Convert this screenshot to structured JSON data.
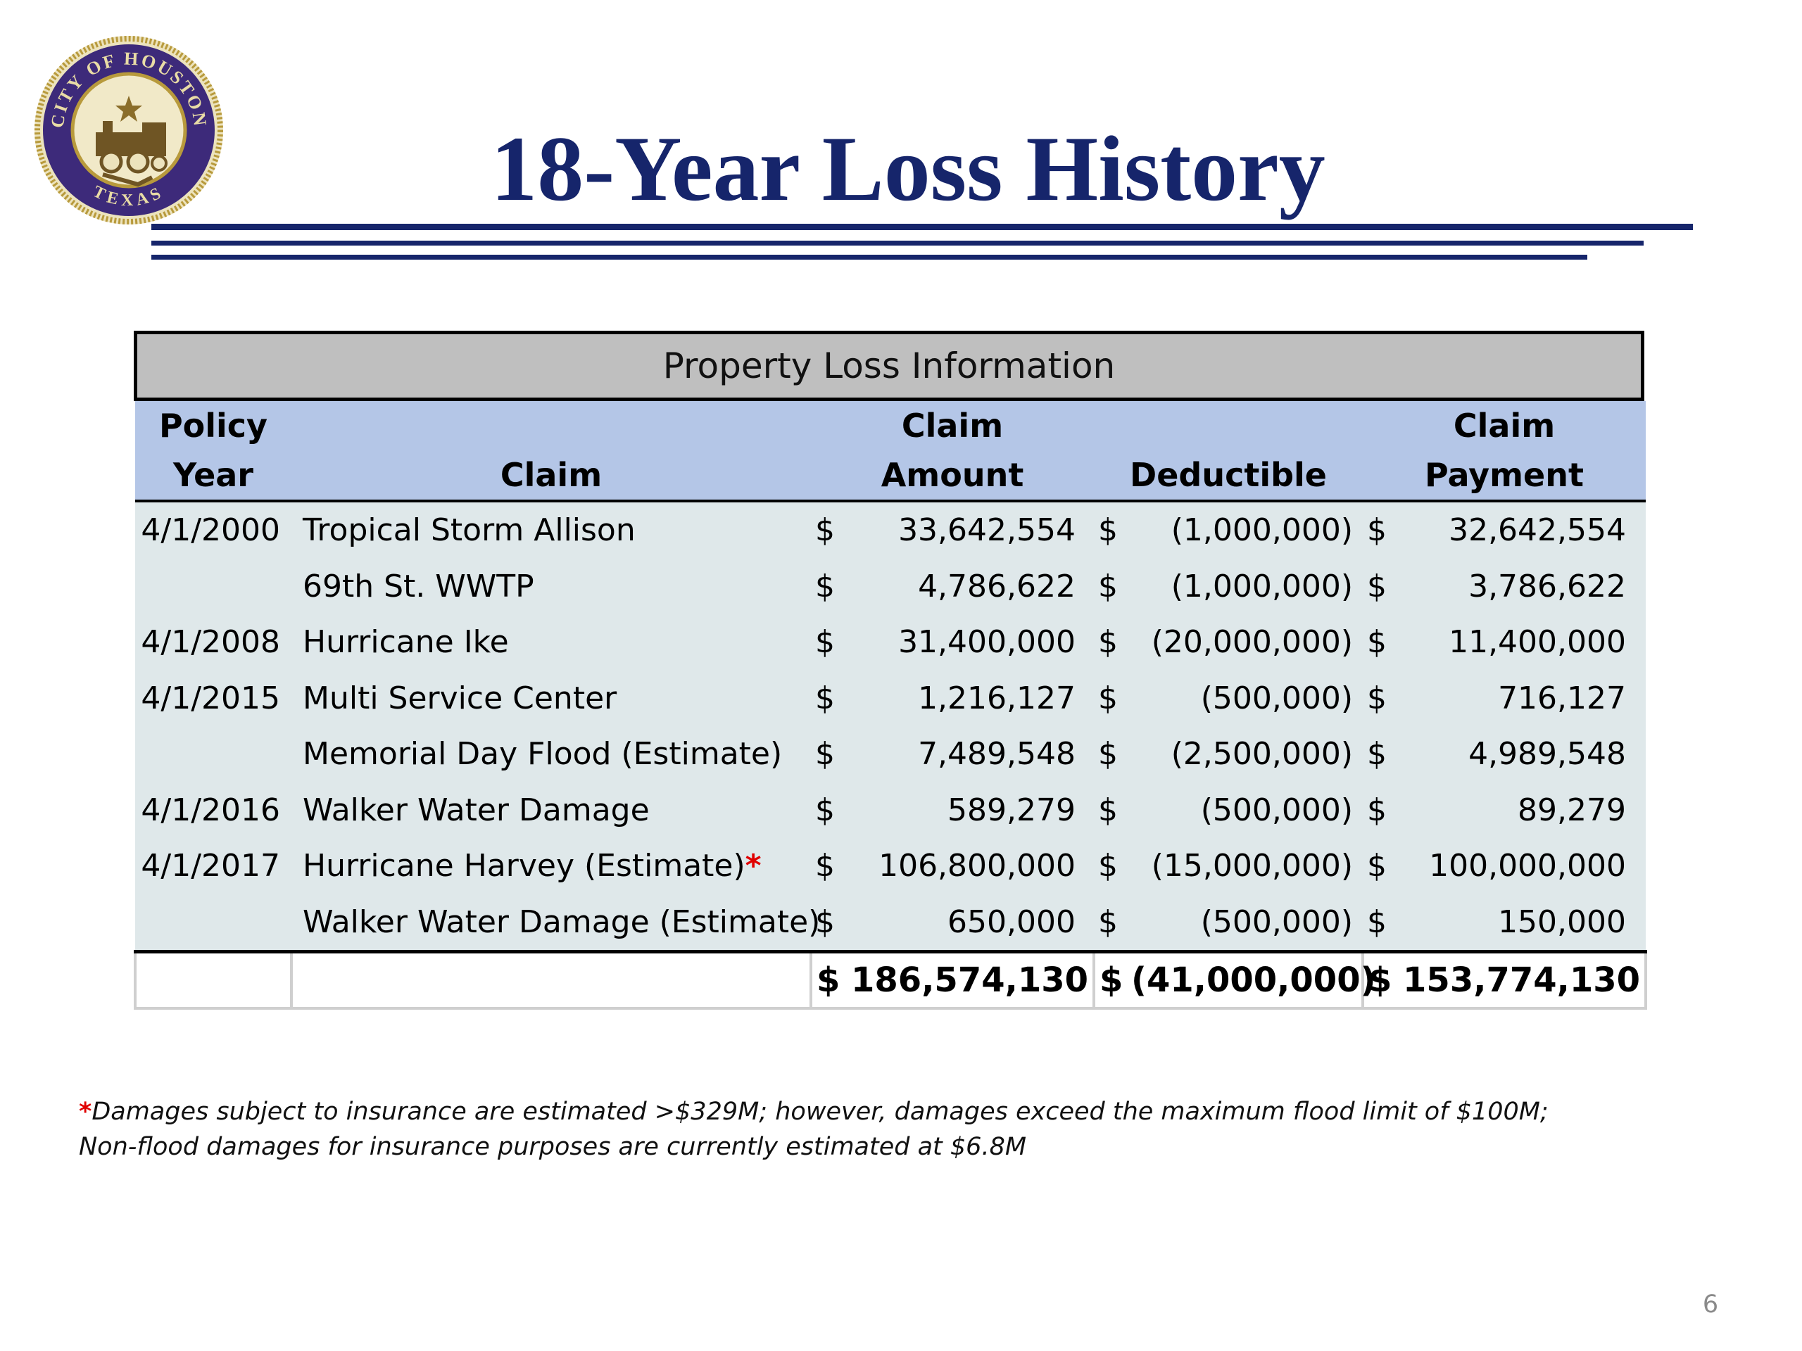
{
  "slide": {
    "title": "18-Year Loss History",
    "page_number": "6"
  },
  "seal": {
    "top_text": "CITY OF HOUSTON",
    "bottom_text": "TEXAS",
    "icon": "locomotive-plow-star-seal"
  },
  "table": {
    "banner": "Property Loss Information",
    "headers": {
      "policy_year": [
        "Policy",
        "Year"
      ],
      "claim": [
        "",
        "Claim"
      ],
      "claim_amount": [
        "Claim",
        "Amount"
      ],
      "deductible": [
        "",
        "Deductible"
      ],
      "claim_payment": [
        "Claim",
        "Payment"
      ]
    },
    "rows": [
      {
        "year": "4/1/2000",
        "claim": "Tropical Storm Allison",
        "amount": "33,642,554",
        "deductible": "(1,000,000)",
        "payment": "32,642,554"
      },
      {
        "year": "",
        "claim": "69th St. WWTP",
        "amount": "4,786,622",
        "deductible": "(1,000,000)",
        "payment": "3,786,622"
      },
      {
        "year": "4/1/2008",
        "claim": "Hurricane Ike",
        "amount": "31,400,000",
        "deductible": "(20,000,000)",
        "payment": "11,400,000"
      },
      {
        "year": "4/1/2015",
        "claim": "Multi Service Center",
        "amount": "1,216,127",
        "deductible": "(500,000)",
        "payment": "716,127"
      },
      {
        "year": "",
        "claim": "Memorial Day Flood (Estimate)",
        "amount": "7,489,548",
        "deductible": "(2,500,000)",
        "payment": "4,989,548"
      },
      {
        "year": "4/1/2016",
        "claim": "Walker Water Damage",
        "amount": "589,279",
        "deductible": "(500,000)",
        "payment": "89,279"
      },
      {
        "year": "4/1/2017",
        "claim": "Hurricane Harvey (Estimate)",
        "claim_mark": "*",
        "amount": "106,800,000",
        "deductible": "(15,000,000)",
        "payment": "100,000,000"
      },
      {
        "year": "",
        "claim": "Walker Water Damage (Estimate)",
        "amount": "650,000",
        "deductible": "(500,000)",
        "payment": "150,000"
      }
    ],
    "currency_symbol": "$",
    "totals": {
      "amount": "186,574,130",
      "deductible": "(41,000,000)",
      "payment": "153,774,130"
    }
  },
  "footnote": {
    "mark": "*",
    "line1": "Damages subject to insurance are estimated >$329M; however, damages exceed the maximum flood limit of $100M;",
    "line2": "Non-flood damages for insurance purposes are currently estimated at $6.8M"
  },
  "colors": {
    "title_navy": "#16256b",
    "banner_gray": "#bfbfbf",
    "header_blue": "#b4c6e7",
    "row_fill": "#dfe8ea",
    "asterisk_red": "#e00000",
    "seal_purple": "#3d2a7a",
    "seal_gold": "#b89a3c"
  }
}
